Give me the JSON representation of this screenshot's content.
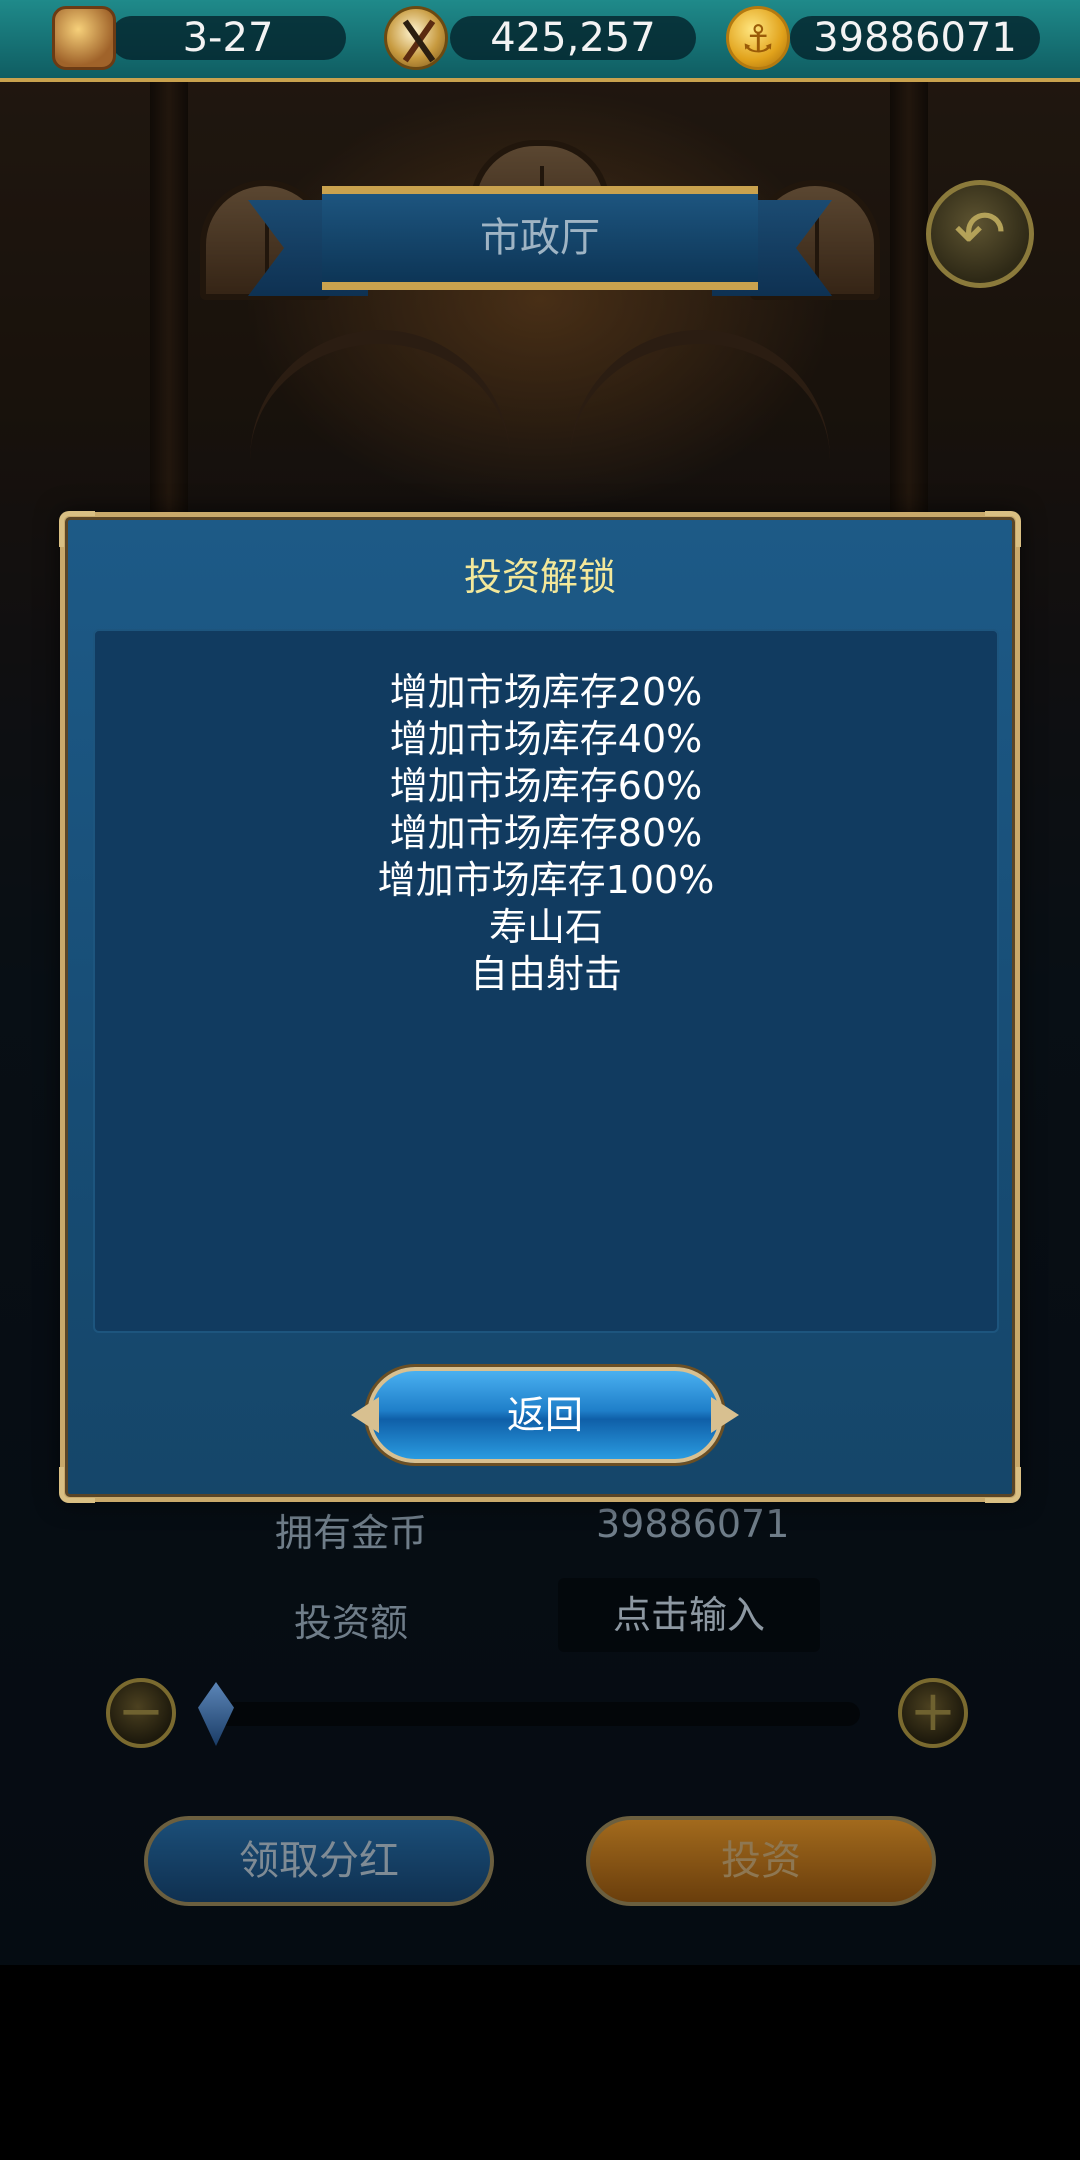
{
  "topbar": {
    "stage": "3-27",
    "compass_value": "425,257",
    "gold": "39886071",
    "icons": [
      "hourglass-icon",
      "compass-icon",
      "coin-icon"
    ]
  },
  "header": {
    "title": "市政厅",
    "back_icon": "back-arrow-icon"
  },
  "background_panel": {
    "owned_gold_label": "拥有金币",
    "owned_gold_value": "39886071",
    "investment_label": "投资额",
    "investment_placeholder": "点击输入",
    "claim_dividend_button": "领取分红",
    "invest_button": "投资"
  },
  "modal": {
    "title": "投资解锁",
    "items": [
      "增加市场库存20%",
      "增加市场库存40%",
      "增加市场库存60%",
      "增加市场库存80%",
      "增加市场库存100%",
      "寿山石",
      "自由射击"
    ],
    "return_button": "返回"
  },
  "colors": {
    "modal_bg": "#174c74",
    "modal_border": "#c9a96b",
    "title_text": "#f3e89a",
    "topbar": "#1f8a8a",
    "button_blue": "#1f7fc9"
  }
}
